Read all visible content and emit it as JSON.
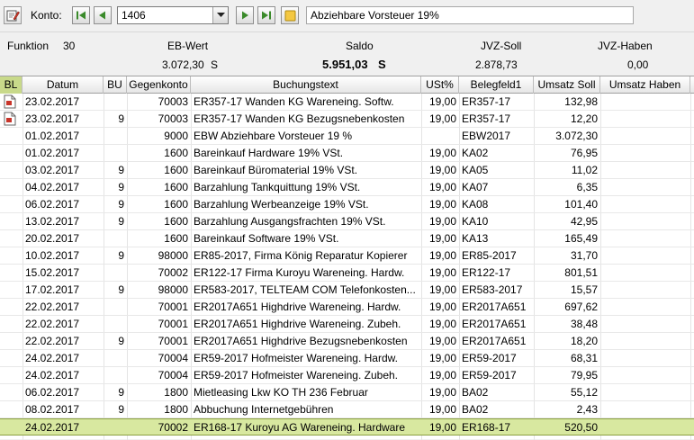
{
  "toolbar": {
    "konto_label": "Konto:",
    "konto_value": "1406",
    "konto_description": "Abziehbare Vorsteuer 19%"
  },
  "summary": {
    "funktion_label": "Funktion",
    "funktion_value": "30",
    "eb_label": "EB-Wert",
    "eb_value": "3.072,30",
    "eb_side": "S",
    "saldo_label": "Saldo",
    "saldo_value": "5.951,03",
    "saldo_side": "S",
    "jvz_soll_label": "JVZ-Soll",
    "jvz_soll_value": "2.878,73",
    "jvz_haben_label": "JVZ-Haben",
    "jvz_haben_value": "0,00"
  },
  "columns": [
    "BL",
    "Datum",
    "BU",
    "Gegenkonto",
    "Buchungstext",
    "USt%",
    "Belegfeld1",
    "Umsatz Soll",
    "Umsatz Haben"
  ],
  "rows": [
    {
      "bl": true,
      "datum": "23.02.2017",
      "bu": "",
      "gegenkonto": "70003",
      "text": "ER357-17 Wanden KG Wareneing. Softw.",
      "ust": "19,00",
      "beleg": "ER357-17",
      "soll": "132,98",
      "haben": ""
    },
    {
      "bl": true,
      "datum": "23.02.2017",
      "bu": "9",
      "gegenkonto": "70003",
      "text": "ER357-17 Wanden KG Bezugsnebenkosten",
      "ust": "19,00",
      "beleg": "ER357-17",
      "soll": "12,20",
      "haben": ""
    },
    {
      "bl": false,
      "datum": "01.02.2017",
      "bu": "",
      "gegenkonto": "9000",
      "text": "EBW Abziehbare Vorsteuer 19 %",
      "ust": "",
      "beleg": "EBW2017",
      "soll": "3.072,30",
      "haben": ""
    },
    {
      "bl": false,
      "datum": "01.02.2017",
      "bu": "",
      "gegenkonto": "1600",
      "text": "Bareinkauf Hardware 19% VSt.",
      "ust": "19,00",
      "beleg": "KA02",
      "soll": "76,95",
      "haben": ""
    },
    {
      "bl": false,
      "datum": "03.02.2017",
      "bu": "9",
      "gegenkonto": "1600",
      "text": "Bareinkauf Büromaterial 19% VSt.",
      "ust": "19,00",
      "beleg": "KA05",
      "soll": "11,02",
      "haben": ""
    },
    {
      "bl": false,
      "datum": "04.02.2017",
      "bu": "9",
      "gegenkonto": "1600",
      "text": "Barzahlung Tankquittung 19% VSt.",
      "ust": "19,00",
      "beleg": "KA07",
      "soll": "6,35",
      "haben": ""
    },
    {
      "bl": false,
      "datum": "06.02.2017",
      "bu": "9",
      "gegenkonto": "1600",
      "text": "Barzahlung Werbeanzeige 19% VSt.",
      "ust": "19,00",
      "beleg": "KA08",
      "soll": "101,40",
      "haben": ""
    },
    {
      "bl": false,
      "datum": "13.02.2017",
      "bu": "9",
      "gegenkonto": "1600",
      "text": "Barzahlung Ausgangsfrachten 19% VSt.",
      "ust": "19,00",
      "beleg": "KA10",
      "soll": "42,95",
      "haben": ""
    },
    {
      "bl": false,
      "datum": "20.02.2017",
      "bu": "",
      "gegenkonto": "1600",
      "text": "Bareinkauf Software 19% VSt.",
      "ust": "19,00",
      "beleg": "KA13",
      "soll": "165,49",
      "haben": ""
    },
    {
      "bl": false,
      "datum": "10.02.2017",
      "bu": "9",
      "gegenkonto": "98000",
      "text": "ER85-2017, Firma König Reparatur Kopierer",
      "ust": "19,00",
      "beleg": "ER85-2017",
      "soll": "31,70",
      "haben": ""
    },
    {
      "bl": false,
      "datum": "15.02.2017",
      "bu": "",
      "gegenkonto": "70002",
      "text": "ER122-17 Firma Kuroyu Wareneing. Hardw.",
      "ust": "19,00",
      "beleg": "ER122-17",
      "soll": "801,51",
      "haben": ""
    },
    {
      "bl": false,
      "datum": "17.02.2017",
      "bu": "9",
      "gegenkonto": "98000",
      "text": "ER583-2017, TELTEAM COM Telefonkosten...",
      "ust": "19,00",
      "beleg": "ER583-2017",
      "soll": "15,57",
      "haben": ""
    },
    {
      "bl": false,
      "datum": "22.02.2017",
      "bu": "",
      "gegenkonto": "70001",
      "text": "ER2017A651 Highdrive Wareneing. Hardw.",
      "ust": "19,00",
      "beleg": "ER2017A651",
      "soll": "697,62",
      "haben": ""
    },
    {
      "bl": false,
      "datum": "22.02.2017",
      "bu": "",
      "gegenkonto": "70001",
      "text": "ER2017A651 Highdrive Wareneing. Zubeh.",
      "ust": "19,00",
      "beleg": "ER2017A651",
      "soll": "38,48",
      "haben": ""
    },
    {
      "bl": false,
      "datum": "22.02.2017",
      "bu": "9",
      "gegenkonto": "70001",
      "text": "ER2017A651 Highdrive Bezugsnebenkosten",
      "ust": "19,00",
      "beleg": "ER2017A651",
      "soll": "18,20",
      "haben": ""
    },
    {
      "bl": false,
      "datum": "24.02.2017",
      "bu": "",
      "gegenkonto": "70004",
      "text": "ER59-2017 Hofmeister Wareneing. Hardw.",
      "ust": "19,00",
      "beleg": "ER59-2017",
      "soll": "68,31",
      "haben": ""
    },
    {
      "bl": false,
      "datum": "24.02.2017",
      "bu": "",
      "gegenkonto": "70004",
      "text": "ER59-2017 Hofmeister Wareneing. Zubeh.",
      "ust": "19,00",
      "beleg": "ER59-2017",
      "soll": "79,95",
      "haben": ""
    },
    {
      "bl": false,
      "datum": "06.02.2017",
      "bu": "9",
      "gegenkonto": "1800",
      "text": "Mietleasing Lkw KO TH 236 Februar",
      "ust": "19,00",
      "beleg": "BA02",
      "soll": "55,12",
      "haben": ""
    },
    {
      "bl": false,
      "datum": "08.02.2017",
      "bu": "9",
      "gegenkonto": "1800",
      "text": "Abbuchung Internetgebühren",
      "ust": "19,00",
      "beleg": "BA02",
      "soll": "2,43",
      "haben": ""
    },
    {
      "bl": false,
      "datum": "24.02.2017",
      "bu": "",
      "gegenkonto": "70002",
      "text": "ER168-17 Kuroyu AG Wareneing. Hardware",
      "ust": "19,00",
      "beleg": "ER168-17",
      "soll": "520,50",
      "haben": "",
      "selected": true
    }
  ]
}
